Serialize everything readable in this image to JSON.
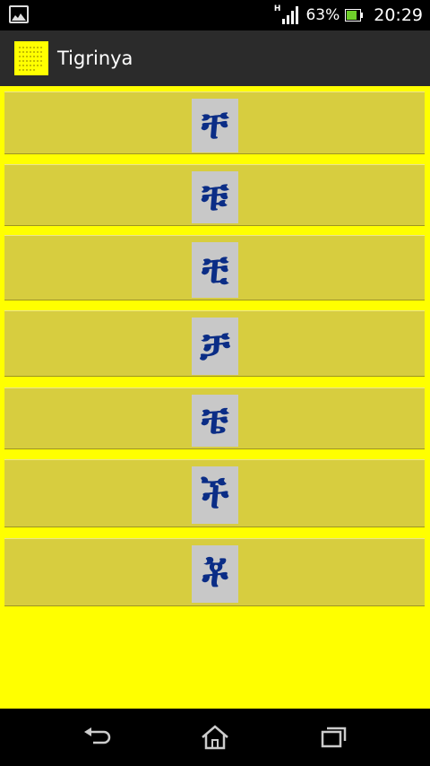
{
  "status_bar": {
    "network_type": "H",
    "battery_percent": "63%",
    "time": "20:29",
    "icons": [
      "gallery-notification-icon",
      "signal-icon",
      "battery-icon"
    ]
  },
  "action_bar": {
    "title": "Tigrinya",
    "app_icon": "tigrinya-app-icon"
  },
  "list": {
    "items": [
      {
        "glyph": "ቸ"
      },
      {
        "glyph": "ቹ"
      },
      {
        "glyph": "ቺ"
      },
      {
        "glyph": "ቻ"
      },
      {
        "glyph": "ቼ"
      },
      {
        "glyph": "ች"
      },
      {
        "glyph": "ቾ"
      }
    ]
  },
  "nav_bar": {
    "buttons": [
      "back-icon",
      "home-icon",
      "recent-apps-icon"
    ]
  },
  "colors": {
    "background": "#ffff00",
    "row": "#d7cd3f",
    "glyph_box": "#c8c8c8",
    "glyph": "#0b2d86",
    "action_bar": "#2b2b2b"
  }
}
